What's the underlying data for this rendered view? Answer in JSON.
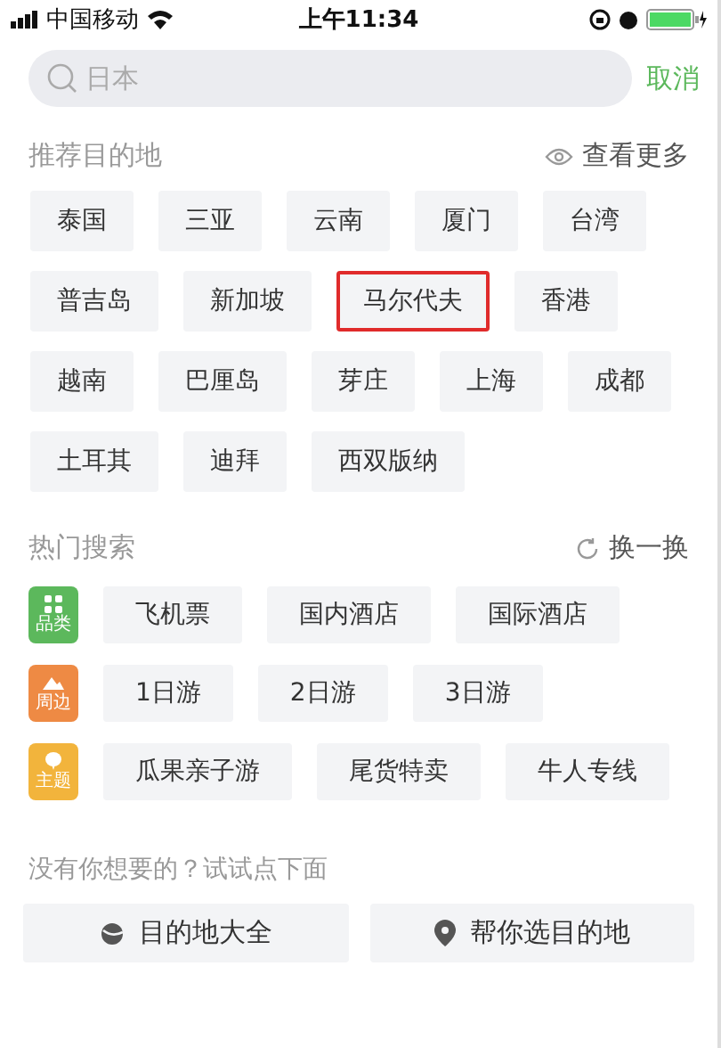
{
  "status_bar": {
    "carrier": "中国移动",
    "time": "上午11:34"
  },
  "search": {
    "placeholder": "日本",
    "cancel": "取消"
  },
  "recommended": {
    "title": "推荐目的地",
    "more": "查看更多",
    "items": [
      {
        "label": "泰国",
        "highlighted": false
      },
      {
        "label": "三亚",
        "highlighted": false
      },
      {
        "label": "云南",
        "highlighted": false
      },
      {
        "label": "厦门",
        "highlighted": false
      },
      {
        "label": "台湾",
        "highlighted": false
      },
      {
        "label": "普吉岛",
        "highlighted": false
      },
      {
        "label": "新加坡",
        "highlighted": false
      },
      {
        "label": "马尔代夫",
        "highlighted": true
      },
      {
        "label": "香港",
        "highlighted": false
      },
      {
        "label": "越南",
        "highlighted": false
      },
      {
        "label": "巴厘岛",
        "highlighted": false
      },
      {
        "label": "芽庄",
        "highlighted": false
      },
      {
        "label": "上海",
        "highlighted": false
      },
      {
        "label": "成都",
        "highlighted": false
      },
      {
        "label": "土耳其",
        "highlighted": false
      },
      {
        "label": "迪拜",
        "highlighted": false
      },
      {
        "label": "西双版纳",
        "highlighted": false
      }
    ]
  },
  "hot": {
    "title": "热门搜索",
    "refresh": "换一换",
    "groups": [
      {
        "kind": "category",
        "label": "品类",
        "color": "#5cb85c",
        "items": [
          "飞机票",
          "国内酒店",
          "国际酒店"
        ]
      },
      {
        "kind": "nearby",
        "label": "周边",
        "color": "#ee8a44",
        "items": [
          "1日游",
          "2日游",
          "3日游"
        ]
      },
      {
        "kind": "theme",
        "label": "主题",
        "color": "#f2b43c",
        "items": [
          "瓜果亲子游",
          "尾货特卖",
          "牛人专线"
        ]
      }
    ]
  },
  "footer": {
    "hint": "没有你想要的？试试点下面",
    "buttons": [
      {
        "kind": "globe",
        "label": "目的地大全"
      },
      {
        "kind": "pin",
        "label": "帮你选目的地"
      }
    ]
  }
}
